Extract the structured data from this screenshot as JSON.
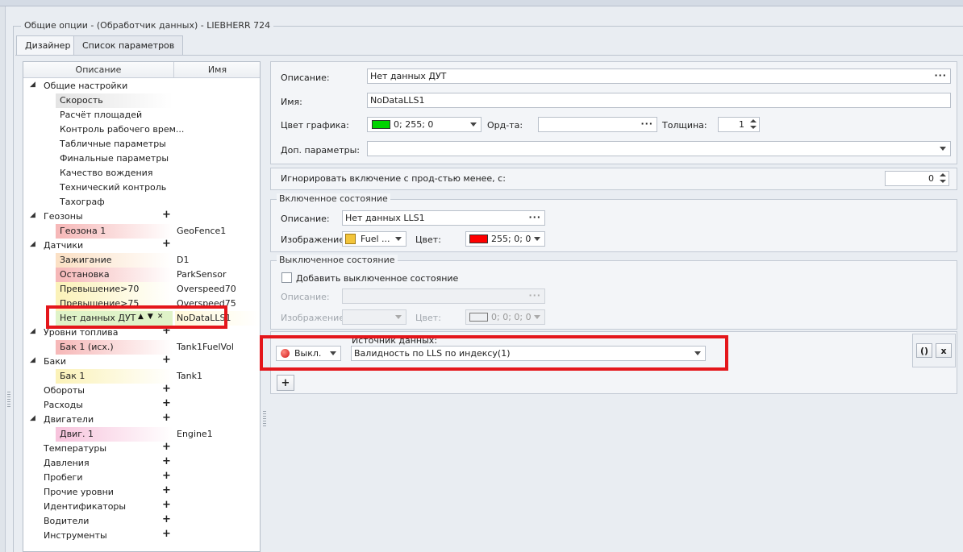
{
  "window": {
    "group_title": "Общие опции - (Обработчик данных) - LIEBHERR 724"
  },
  "tabs": [
    {
      "label": "Дизайнер"
    },
    {
      "label": "Список параметров"
    }
  ],
  "tree": {
    "columns": {
      "description": "Описание",
      "name": "Имя"
    },
    "rows": [
      {
        "label": "Общие настройки",
        "name": ""
      },
      {
        "label": "Скорость",
        "name": ""
      },
      {
        "label": "Расчёт площадей",
        "name": ""
      },
      {
        "label": "Контроль рабочего врем...",
        "name": ""
      },
      {
        "label": "Табличные параметры",
        "name": ""
      },
      {
        "label": "Финальные параметры",
        "name": ""
      },
      {
        "label": "Качество вождения",
        "name": ""
      },
      {
        "label": "Технический контроль",
        "name": ""
      },
      {
        "label": "Тахограф",
        "name": ""
      },
      {
        "label": "Геозоны",
        "name": ""
      },
      {
        "label": "Геозона 1",
        "name": "GeoFence1"
      },
      {
        "label": "Датчики",
        "name": ""
      },
      {
        "label": "Зажигание",
        "name": "D1"
      },
      {
        "label": "Остановка",
        "name": "ParkSensor"
      },
      {
        "label": "Превышение>70",
        "name": "Overspeed70"
      },
      {
        "label": "Превышение>75",
        "name": "Overspeed75"
      },
      {
        "label": "Нет данных ДУТ",
        "name": "NoDataLLS1"
      },
      {
        "label": "Уровни топлива",
        "name": ""
      },
      {
        "label": "Бак 1 (исх.)",
        "name": "Tank1FuelVol"
      },
      {
        "label": "Баки",
        "name": ""
      },
      {
        "label": "Бак 1",
        "name": "Tank1"
      },
      {
        "label": "Обороты",
        "name": ""
      },
      {
        "label": "Расходы",
        "name": ""
      },
      {
        "label": "Двигатели",
        "name": ""
      },
      {
        "label": "Двиг. 1",
        "name": "Engine1"
      },
      {
        "label": "Температуры",
        "name": ""
      },
      {
        "label": "Давления",
        "name": ""
      },
      {
        "label": "Пробеги",
        "name": ""
      },
      {
        "label": "Прочие уровни",
        "name": ""
      },
      {
        "label": "Идентификаторы",
        "name": ""
      },
      {
        "label": "Водители",
        "name": ""
      },
      {
        "label": "Инструменты",
        "name": ""
      }
    ]
  },
  "props": {
    "description_label": "Описание:",
    "description_value": "Нет данных ДУТ",
    "name_label": "Имя:",
    "name_value": "NoDataLLS1",
    "graph_color_label": "Цвет графика:",
    "graph_color_value": "0; 255; 0",
    "graph_color_hex": "#00d400",
    "ord_label": "Орд-та:",
    "ord_value": "",
    "thickness_label": "Толщина:",
    "thickness_value": "1",
    "extra_label": "Доп. параметры:",
    "extra_value": ""
  },
  "ignore": {
    "label": "Игнорировать включение с прод-стью менее, с:",
    "value": "0"
  },
  "on_state": {
    "title": "Включенное состояние",
    "description_label": "Описание:",
    "description_value": "Нет данных LLS1",
    "image_label": "Изображение:",
    "image_value": "Fuel ...",
    "color_label": "Цвет:",
    "color_value": "255; 0; 0",
    "color_hex": "#ff0000"
  },
  "off_state": {
    "title": "Выключенное состояние",
    "add_label": "Добавить выключенное состояние",
    "description_label": "Описание:",
    "image_label": "Изображение:",
    "color_label": "Цвет:",
    "color_value": "0; 0; 0; 0"
  },
  "source": {
    "title": "Источник данных:",
    "mode_value": "Выкл.",
    "value": "Валидность по LLS по индексу(1)",
    "add_button": "+",
    "paren_button": "()",
    "close_button": "x"
  }
}
